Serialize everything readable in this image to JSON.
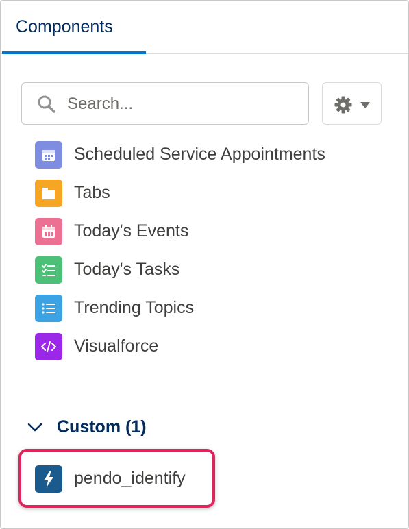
{
  "tabs": [
    {
      "label": "Components",
      "active": true
    }
  ],
  "search": {
    "placeholder": "Search..."
  },
  "standard_components": [
    {
      "label": "Scheduled Service Appointments",
      "icon": "calendar-grid-icon",
      "color": "#7f8de1"
    },
    {
      "label": "Tabs",
      "icon": "folder-tab-icon",
      "color": "#f6a623"
    },
    {
      "label": "Today's Events",
      "icon": "calendar-icon",
      "color": "#eb7092"
    },
    {
      "label": "Today's Tasks",
      "icon": "checklist-icon",
      "color": "#4bc076"
    },
    {
      "label": "Trending Topics",
      "icon": "list-icon",
      "color": "#3ba3e3"
    },
    {
      "label": "Visualforce",
      "icon": "code-icon",
      "color": "#9b27e8"
    }
  ],
  "custom_section": {
    "title": "Custom (1)",
    "expanded": true,
    "items": [
      {
        "label": "pendo_identify",
        "icon": "lightning-bolt-icon",
        "color": "#1b5a8c"
      }
    ]
  },
  "colors": {
    "tab_underline": "#0176d3",
    "highlight_border": "#e0245e",
    "heading": "#032d60"
  }
}
